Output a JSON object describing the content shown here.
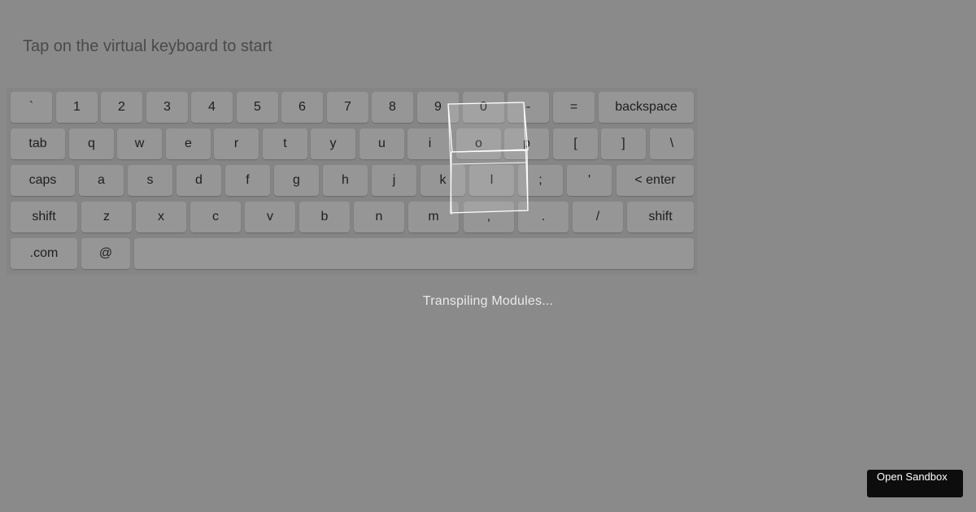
{
  "prompt": "Tap on the virtual keyboard to start",
  "keyboard": {
    "rows": [
      [
        "`",
        "1",
        "2",
        "3",
        "4",
        "5",
        "6",
        "7",
        "8",
        "9",
        "0",
        "-",
        "=",
        "backspace"
      ],
      [
        "tab",
        "q",
        "w",
        "e",
        "r",
        "t",
        "y",
        "u",
        "i",
        "o",
        "p",
        "[",
        "]",
        "\\"
      ],
      [
        "caps",
        "a",
        "s",
        "d",
        "f",
        "g",
        "h",
        "j",
        "k",
        "l",
        ";",
        "'",
        "< enter"
      ],
      [
        "shift",
        "z",
        "x",
        "c",
        "v",
        "b",
        "n",
        "m",
        ",",
        ".",
        "/",
        "shift"
      ],
      [
        ".com",
        "@",
        " "
      ]
    ]
  },
  "loading": {
    "text": "Transpiling Modules..."
  },
  "sandbox": {
    "label": "Open Sandbox"
  }
}
